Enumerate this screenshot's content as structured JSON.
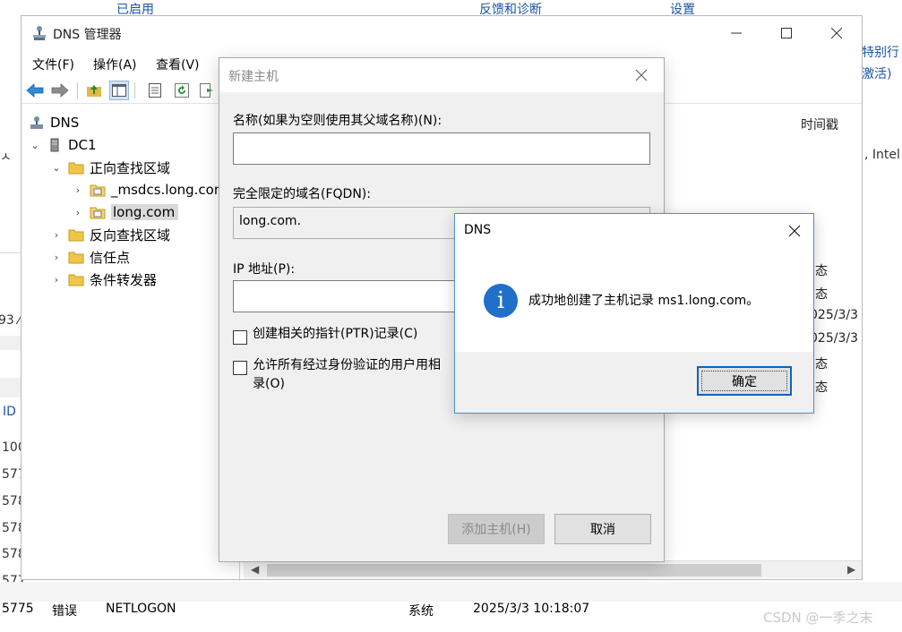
{
  "background": {
    "top_items": [
      "已启用",
      "反馈和诊断",
      "设置"
    ],
    "right_fragments": [
      "特别行",
      "激活)",
      ", Intel"
    ],
    "left_fragments": [
      "ㅅ",
      "93 ⁄",
      "ID",
      "100",
      "577",
      "578",
      "578",
      "578",
      "577",
      "577"
    ],
    "bottom_row": [
      "5775",
      "错误",
      "NETLOGON",
      "系统",
      "2025/3/3 10:18:07"
    ],
    "watermark": "CSDN @一季之末"
  },
  "window": {
    "title": "DNS 管理器",
    "menu": [
      "文件(F)",
      "操作(A)",
      "查看(V)"
    ]
  },
  "tree": {
    "root": "DNS",
    "server": "DC1",
    "forward_zone": "正向查找区域",
    "msdcs": "_msdcs.long.com",
    "long": "long.com",
    "reverse_zone": "反向查找区域",
    "trust_points": "信任点",
    "conditional_forwarders": "条件转发器"
  },
  "list": {
    "column_timestamp": "时间戳",
    "right_frags": [
      "态",
      "态",
      "025/3/3",
      "025/3/3",
      "态",
      "态"
    ]
  },
  "new_host_dialog": {
    "title": "新建主机",
    "name_label": "名称(如果为空则使用其父域名称)(N):",
    "name_value": "",
    "fqdn_label": "完全限定的域名(FQDN):",
    "fqdn_value": "long.com.",
    "ip_label": "IP 地址(P):",
    "ip_value": "",
    "ptr_checkbox": "创建相关的指针(PTR)记录(C)",
    "allow_checkbox_line1": "允许所有经过身份验证的用户用相",
    "allow_checkbox_line2": "录(O)",
    "add_button": "添加主机(H)",
    "cancel_button": "取消"
  },
  "message_box": {
    "title": "DNS",
    "message": "成功地创建了主机记录 ms1.long.com。",
    "ok_button": "确定"
  }
}
